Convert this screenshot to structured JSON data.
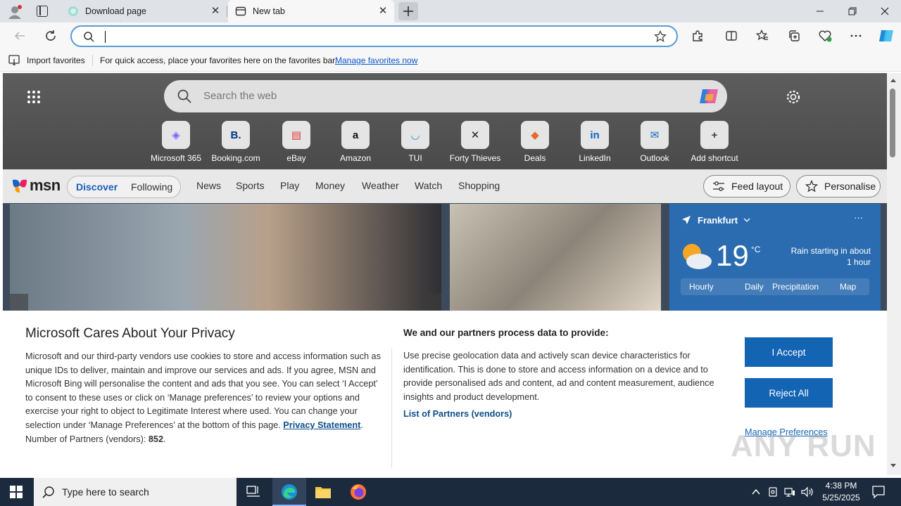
{
  "browser": {
    "tabs": [
      {
        "title": "Download page"
      },
      {
        "title": "New tab"
      }
    ],
    "address": {
      "value": ""
    },
    "favorites_bar": {
      "import_label": "Import favorites",
      "message": "For quick access, place your favorites here on the favorites bar.",
      "manage_link": "Manage favorites now"
    }
  },
  "newtab": {
    "search_placeholder": "Search the web",
    "shortcuts": [
      {
        "label": "Microsoft 365",
        "glyph": "◈"
      },
      {
        "label": "Booking.com",
        "glyph": "B."
      },
      {
        "label": "eBay",
        "glyph": "▤"
      },
      {
        "label": "Amazon",
        "glyph": "a"
      },
      {
        "label": "TUI",
        "glyph": "◡"
      },
      {
        "label": "Forty Thieves",
        "glyph": "✕"
      },
      {
        "label": "Deals",
        "glyph": "◆"
      },
      {
        "label": "LinkedIn",
        "glyph": "in"
      },
      {
        "label": "Outlook",
        "glyph": "✉"
      },
      {
        "label": "Add shortcut",
        "glyph": "+"
      }
    ],
    "msn": {
      "logo": "msn",
      "tabs": [
        "Discover",
        "Following"
      ],
      "nav": [
        "News",
        "Sports",
        "Play",
        "Money",
        "Weather",
        "Watch",
        "Shopping"
      ],
      "feed_layout": "Feed layout",
      "personalise": "Personalise"
    },
    "weather": {
      "city": "Frankfurt",
      "temp": "19",
      "unit": "°C",
      "summary_line1": "Rain starting in about",
      "summary_line2": "1 hour",
      "tabs": [
        "Hourly",
        "Daily",
        "Precipitation",
        "Map"
      ]
    }
  },
  "privacy": {
    "title": "Microsoft Cares About Your Privacy",
    "body": "Microsoft and our third-party vendors use cookies to store and access information such as unique IDs to deliver, maintain and improve our services and ads. If you agree, MSN and Microsoft Bing will personalise the content and ads that you see. You can select ‘I Accept’ to consent to these uses or click on ‘Manage preferences’ to review your options and exercise your right to object to Legitimate Interest where used.  You can change your selection under ‘Manage Preferences’ at the bottom of this page.",
    "privacy_link": "Privacy Statement",
    "partners_label": "Number of Partners (vendors):",
    "partners_count": "852",
    "purposes_title": "We and our partners process data to provide:",
    "purposes_body": "Use precise geolocation data and actively scan device characteristics for identification. This is done to store and access information on a device and to provide personalised ads and content, ad and content measurement, audience insights and product development.",
    "partners_link": "List of Partners (vendors)",
    "accept": "I Accept",
    "reject": "Reject All",
    "manage": "Manage Preferences"
  },
  "taskbar": {
    "search_placeholder": "Type here to search",
    "time": "4:38 PM",
    "date": "5/25/2025"
  },
  "watermark": "ANY RUN"
}
